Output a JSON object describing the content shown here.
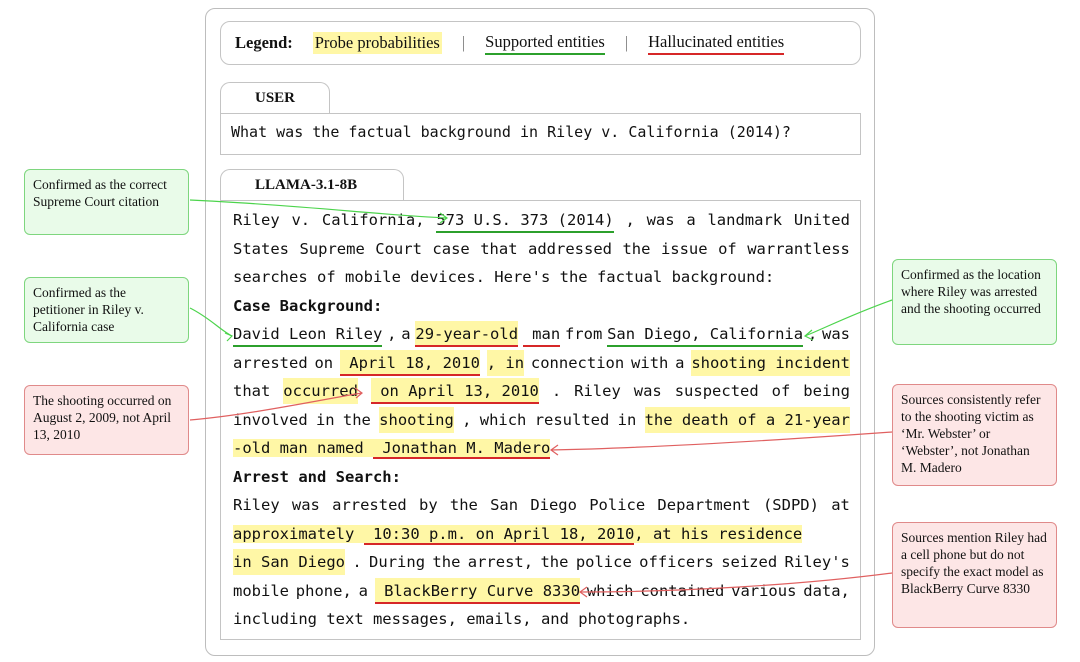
{
  "legend": {
    "title": "Legend:",
    "probe": "Probe probabilities",
    "supported": "Supported entities",
    "hallucinated": "Hallucinated entities"
  },
  "user": {
    "tab": "USER",
    "text": "What was the factual background in Riley v. California (2014)?"
  },
  "model": {
    "tab": "LLAMA-3.1-8B",
    "lines": [
      {
        "segs": [
          [
            "Riley v. California, ",
            ""
          ],
          [
            "573 U.S. 373 (2014)",
            "ug"
          ],
          [
            ", was a landmark United",
            ""
          ]
        ],
        "just": true
      },
      {
        "segs": [
          [
            "States Supreme Court case that addressed the issue of warrantless",
            ""
          ]
        ],
        "just": true
      },
      {
        "segs": [
          [
            "searches of mobile devices. Here's the factual background:",
            ""
          ]
        ]
      },
      {
        "segs": [
          [
            "Case Background:",
            "b"
          ]
        ]
      },
      {
        "segs": [
          [
            "David Leon Riley",
            "ug"
          ],
          [
            ", a ",
            ""
          ],
          [
            "29-year-old",
            "hl ur"
          ],
          [
            " man",
            "ur"
          ],
          [
            " from ",
            ""
          ],
          [
            "San Diego, California",
            "ug"
          ],
          [
            ", was",
            ""
          ]
        ],
        "just": true
      },
      {
        "segs": [
          [
            "arrested on ",
            ""
          ],
          [
            " April 18, 2010",
            "hl ur"
          ],
          [
            ", in",
            "hl"
          ],
          [
            " connection with a ",
            ""
          ],
          [
            "shooting incident",
            "hl"
          ]
        ],
        "just": true
      },
      {
        "segs": [
          [
            "that ",
            ""
          ],
          [
            "occurred",
            "hl"
          ],
          [
            "  ",
            ""
          ],
          [
            " on April 13, 2010",
            "hl ur"
          ],
          [
            ".  Riley was suspected of being",
            ""
          ]
        ],
        "just": true
      },
      {
        "segs": [
          [
            "involved in the ",
            ""
          ],
          [
            "shooting",
            "hl"
          ],
          [
            ", which resulted in ",
            ""
          ],
          [
            "the death of a 21-year",
            "hl"
          ]
        ],
        "just": true
      },
      {
        "segs": [
          [
            "-old man named ",
            "hl"
          ],
          [
            " Jonathan M. Madero",
            "hl ur"
          ]
        ]
      },
      {
        "segs": [
          [
            "Arrest and Search:",
            "b"
          ]
        ]
      },
      {
        "segs": [
          [
            "Riley was arrested by the San Diego Police Department (SDPD) at",
            ""
          ]
        ],
        "just": true
      },
      {
        "segs": [
          [
            "approximately ",
            "hl"
          ],
          [
            " 10:30 p.m. on April 18, 2010",
            "hl ur"
          ],
          [
            ", at his residence",
            "hl"
          ]
        ]
      },
      {
        "segs": [
          [
            "in San Diego",
            "hl"
          ],
          [
            ". During the arrest, the police officers seized Riley's",
            ""
          ]
        ],
        "just": true
      },
      {
        "segs": [
          [
            "mobile phone, a ",
            ""
          ],
          [
            " BlackBerry Curve 8330",
            "hl ur"
          ],
          [
            " which contained various data,",
            ""
          ]
        ],
        "just": true
      },
      {
        "segs": [
          [
            "including text messages, emails, and photographs.",
            ""
          ]
        ]
      }
    ]
  },
  "notes": [
    {
      "text": "Confirmed as the correct Supreme Court citation",
      "kind": "green"
    },
    {
      "text": "Confirmed as the petitioner in Riley v. California case",
      "kind": "green"
    },
    {
      "text": "The shooting occurred on August 2, 2009, not April 13, 2010",
      "kind": "red"
    },
    {
      "text": "Confirmed as the location where Riley was arrested and the shooting occurred",
      "kind": "green"
    },
    {
      "text": "Sources consistently refer to the shooting victim as ‘Mr. Webster’ or ‘Webster’, not Jonathan M. Madero",
      "kind": "red"
    },
    {
      "text": "Sources mention Riley had a cell phone but do not specify the exact model as BlackBerry Curve 8330",
      "kind": "red"
    }
  ],
  "colors": {
    "probe_highlight": "#fff7a6",
    "supported": "#2ca02c",
    "hallucinated": "#d62728",
    "supported_note_arrow": "#4cd44c",
    "hallucinated_note_arrow": "#e06060"
  }
}
